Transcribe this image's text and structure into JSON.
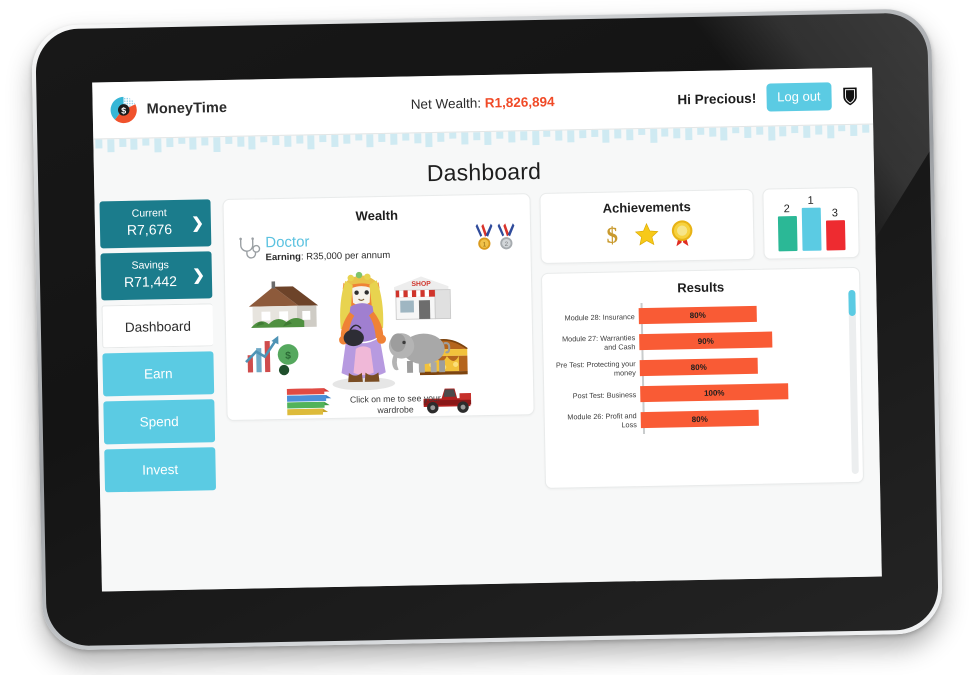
{
  "header": {
    "brand_name": "MoneyTime",
    "logo_icon": "moneytime-dollar-ring-logo",
    "net_wealth_label": "Net Wealth:",
    "net_wealth_value": "R1,826,894",
    "greeting": "Hi Precious!",
    "logout_label": "Log out",
    "shield_icon": "shield-icon",
    "accent_orange": "#f04a27",
    "accent_cyan": "#5bcbe3"
  },
  "page": {
    "title": "Dashboard"
  },
  "sidebar": {
    "accounts": [
      {
        "label": "Current",
        "value": "R7,676",
        "chevron": "❯"
      },
      {
        "label": "Savings",
        "value": "R71,442",
        "chevron": "❯"
      }
    ],
    "items": [
      {
        "label": "Dashboard",
        "active": true
      },
      {
        "label": "Earn",
        "active": false
      },
      {
        "label": "Spend",
        "active": false
      },
      {
        "label": "Invest",
        "active": false
      }
    ]
  },
  "wealth": {
    "title": "Wealth",
    "job_icon": "stethoscope-icon",
    "job_name": "Doctor",
    "earning_label": "Earning",
    "earning_value": "R35,000 per annum",
    "medals": [
      {
        "icon": "gold-medal-icon",
        "rank": "1"
      },
      {
        "icon": "silver-medal-icon",
        "rank": "2"
      }
    ],
    "assets": [
      {
        "icon": "house-icon"
      },
      {
        "icon": "shop-icon"
      },
      {
        "icon": "investment-chart-icon"
      },
      {
        "icon": "treasure-chest-icon"
      },
      {
        "icon": "books-icon"
      },
      {
        "icon": "car-icon"
      },
      {
        "icon": "elephant-pet-icon"
      },
      {
        "icon": "avatar-character-icon"
      }
    ],
    "wardrobe_caption": "Click on me to see your wardrobe"
  },
  "achievements": {
    "title": "Achievements",
    "icons": [
      {
        "name": "dollar-trophy-icon",
        "glyph": "💲"
      },
      {
        "name": "gold-star-icon",
        "glyph": "⭐"
      },
      {
        "name": "rosette-award-icon",
        "glyph": "🏅"
      }
    ]
  },
  "results": {
    "title": "Results",
    "scrollbar": "results-scrollbar"
  },
  "chart_data": [
    {
      "type": "bar",
      "title": "",
      "categories": [
        "2",
        "1",
        "3"
      ],
      "values": [
        55,
        78,
        44
      ],
      "colors": [
        "#2bb896",
        "#5bcbe3",
        "#ee2b30"
      ],
      "orientation": "vertical",
      "grid": false,
      "ylim": [
        0,
        100
      ],
      "xlabel": "",
      "ylabel": "",
      "legend": "none",
      "data_labels": [
        "2",
        "1",
        "3"
      ]
    },
    {
      "type": "bar",
      "title": "Results",
      "orientation": "horizontal",
      "categories": [
        "Module 28: Insurance",
        "Module 27: Warranties and Cash",
        "Pre Test: Protecting your money",
        "Post Test: Business",
        "Module 26: Profit and Loss"
      ],
      "values": [
        80,
        90,
        80,
        100,
        80
      ],
      "data_labels": [
        "80%",
        "90%",
        "80%",
        "100%",
        "80%"
      ],
      "bar_color": "#f95b35",
      "xlim": [
        0,
        100
      ],
      "xlabel": "",
      "ylabel": "",
      "grid": false,
      "legend": "none"
    }
  ]
}
